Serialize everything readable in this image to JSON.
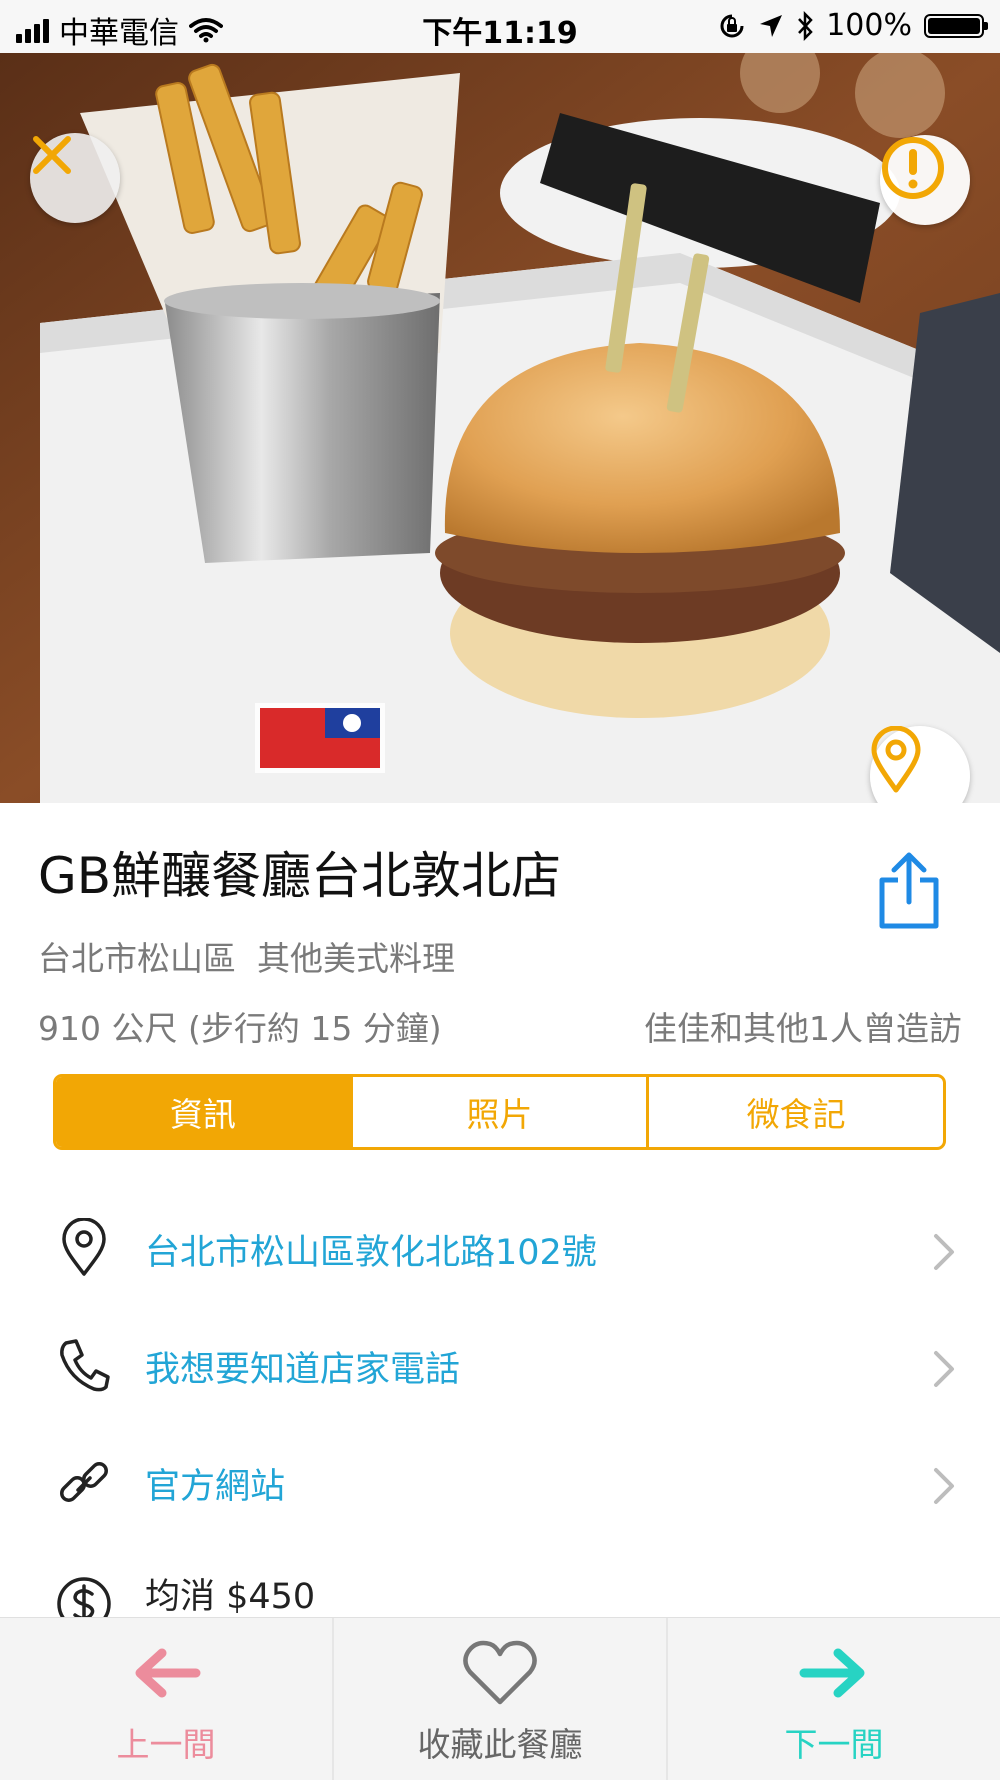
{
  "status_bar": {
    "carrier": "中華電信",
    "time": "下午11:19",
    "battery": "100%"
  },
  "restaurant": {
    "name": "GB鮮釀餐廳台北敦北店",
    "district": "台北市松山區",
    "cuisine": "其他美式料理",
    "distance": "910 公尺 (步行約 15 分鐘)",
    "visits": "佳佳和其他1人曾造訪"
  },
  "tabs": [
    {
      "label": "資訊",
      "active": true
    },
    {
      "label": "照片",
      "active": false
    },
    {
      "label": "微食記",
      "active": false
    }
  ],
  "info_rows": {
    "address": "台北市松山區敦化北路102號",
    "phone": "我想要知道店家電話",
    "website": "官方網站",
    "price": "均消 $450"
  },
  "bottom_bar": {
    "prev": "上一間",
    "favorite": "收藏此餐廳",
    "next": "下一間"
  },
  "colors": {
    "accent": "#f2a705",
    "link": "#22a5d6",
    "prev": "#ec8c9c",
    "next": "#27d3c3",
    "share": "#1f8ae5"
  },
  "icons": [
    "close-icon",
    "report-icon",
    "map-pin-icon",
    "share-icon",
    "location-icon",
    "phone-icon",
    "link-icon",
    "dollar-icon",
    "chevron-right-icon",
    "arrow-left-icon",
    "heart-icon",
    "arrow-right-icon"
  ]
}
